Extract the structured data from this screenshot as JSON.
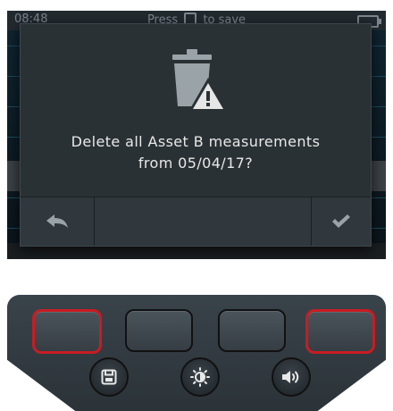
{
  "status_bar": {
    "time": "08:48",
    "hint_before": "Press",
    "hint_after": "to save",
    "hint_icon": "save-icon",
    "battery_icon": "battery-icon"
  },
  "dialog": {
    "icon": "trash-warning-icon",
    "message_line1": "Delete all Asset B measurements",
    "message_line2": "from 05/04/17?",
    "buttons": [
      {
        "name": "back",
        "icon": "back-arrow-icon"
      },
      {
        "name": "middle",
        "icon": ""
      },
      {
        "name": "confirm",
        "icon": "checkmark-icon"
      }
    ]
  },
  "keypad": {
    "soft_keys": [
      "soft-key-1",
      "soft-key-2",
      "soft-key-3",
      "soft-key-4"
    ],
    "highlighted_soft_keys": [
      1,
      4
    ],
    "round_keys": [
      {
        "name": "save",
        "icon": "save-icon"
      },
      {
        "name": "brightness",
        "icon": "brightness-icon"
      },
      {
        "name": "volume",
        "icon": "speaker-icon"
      }
    ]
  },
  "colors": {
    "highlight": "#c81c22",
    "dialog_bg": "#2a3135",
    "icon_grey": "#9aa3a8",
    "text": "#e8e8e8"
  }
}
